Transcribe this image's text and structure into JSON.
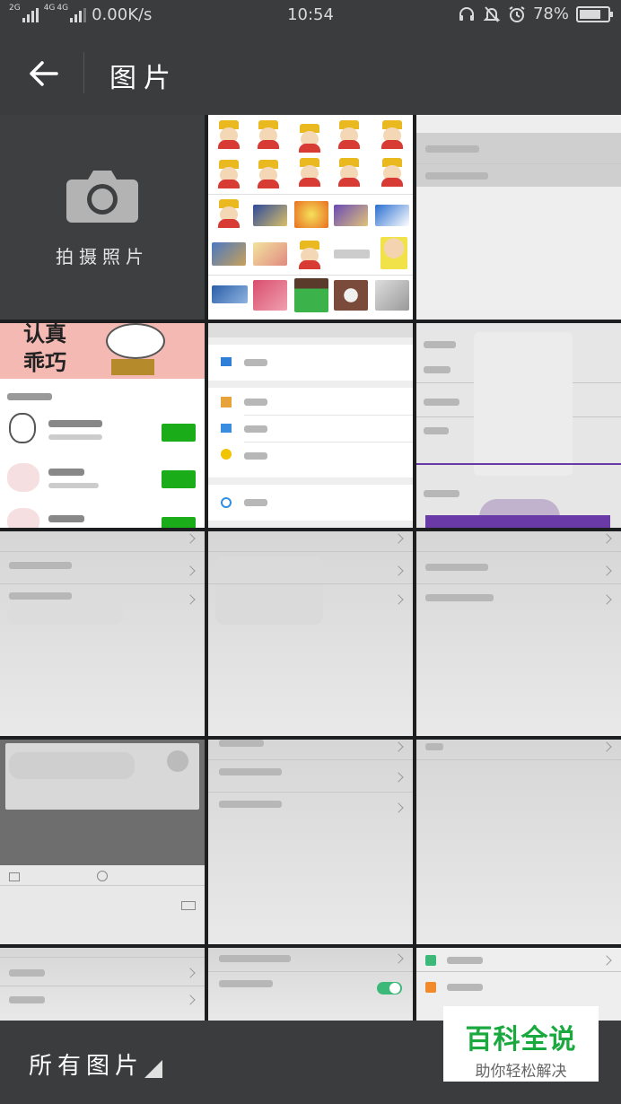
{
  "status_bar": {
    "network_1": "2G",
    "network_2": "4G",
    "network_3": "4G",
    "speed": "0.00K/s",
    "time": "10:54",
    "battery_percent": "78%",
    "battery_level": 0.78
  },
  "header": {
    "title": "图片"
  },
  "camera": {
    "label": "拍摄照片"
  },
  "thumb_texts": {
    "sticker_title_line1": "认真",
    "sticker_title_line2": "乖巧"
  },
  "footer": {
    "album_label": "所有图片"
  },
  "watermark": {
    "main": "百科全说",
    "sub": "助你轻松解决"
  },
  "colors": {
    "bar_bg": "#3b3c3e",
    "accent_green": "#19a93f",
    "wechat_green": "#1aad19"
  }
}
